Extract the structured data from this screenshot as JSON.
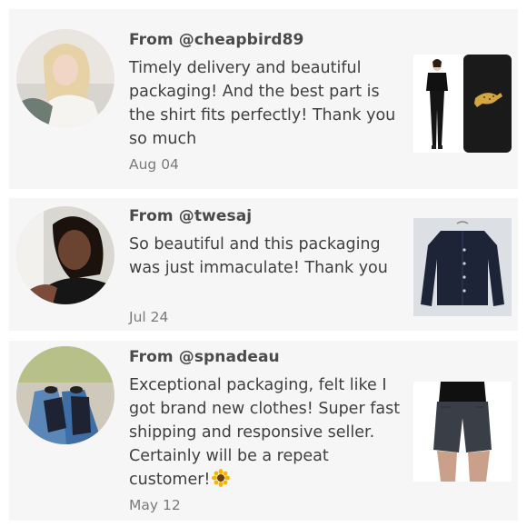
{
  "reviews": [
    {
      "from": "From @cheapbird89",
      "text": "Timely delivery and beautiful packaging! And the best part is the shirt fits perfectly! Thank you so much",
      "date": "Aug 04",
      "avatar_icon": "user-avatar-photo",
      "thumbnail_icon": "black-tshirt-leopard-photo"
    },
    {
      "from": "From @twesaj",
      "text": "So beautiful and this packaging was just immaculate! Thank you",
      "date": "Jul 24",
      "avatar_icon": "user-avatar-photo",
      "thumbnail_icon": "navy-cardigan-photo"
    },
    {
      "from": "From @spnadeau",
      "text": "Exceptional packaging, felt like I got brand new clothes! Super fast shipping and responsive seller. Certainly will be a repeat customer!",
      "date": "May 12",
      "emoji": "sunflower",
      "avatar_icon": "user-avatar-photo",
      "thumbnail_icon": "grey-shorts-photo"
    }
  ],
  "colors": {
    "card_bg": "#f7f6f7",
    "text": "#3f3f3f",
    "muted": "#7a7a7a"
  }
}
